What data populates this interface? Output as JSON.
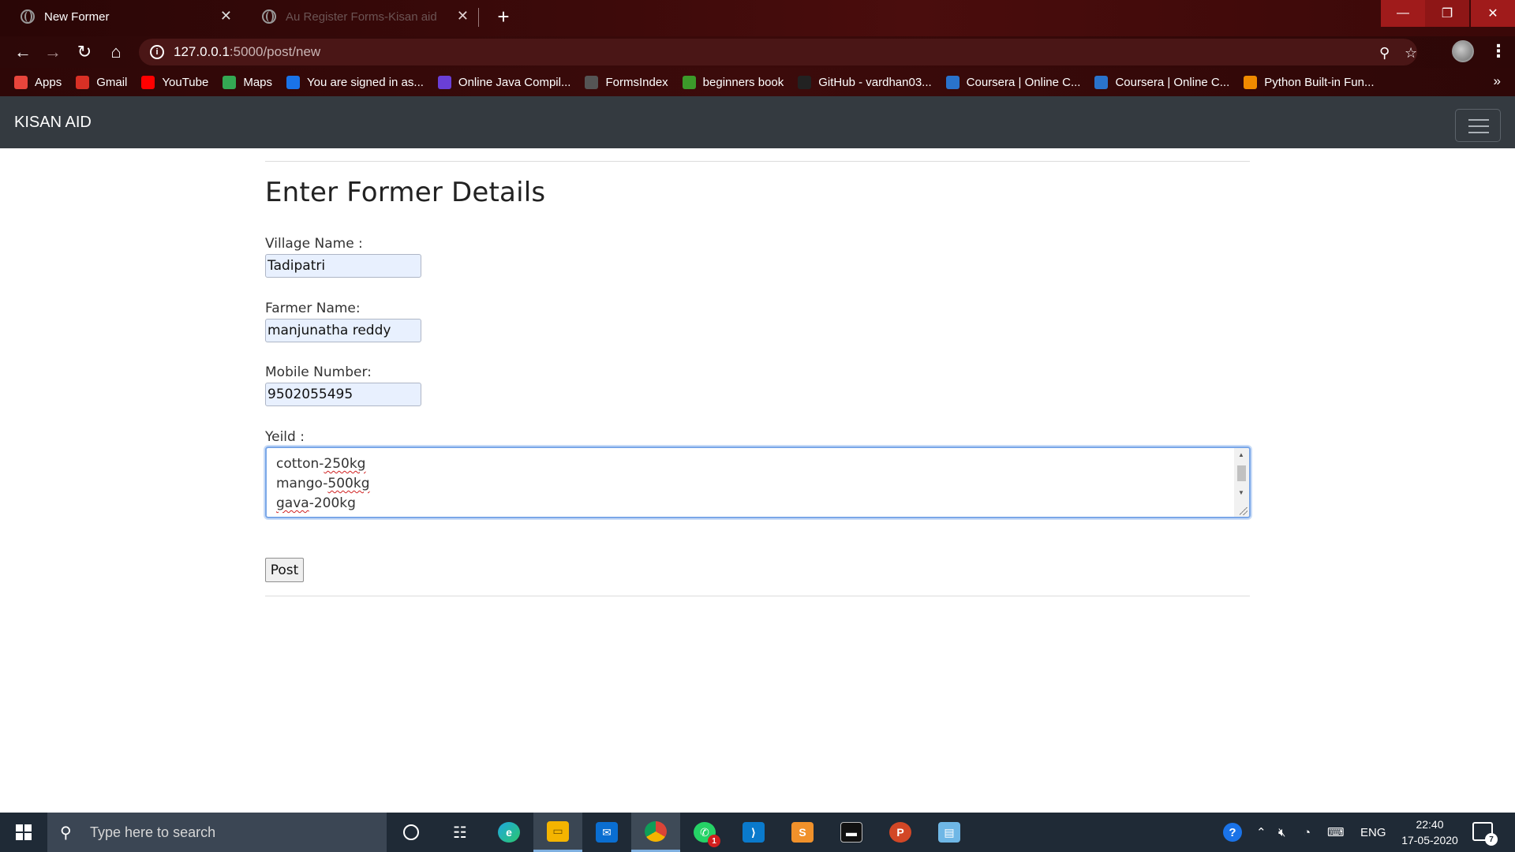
{
  "browser": {
    "tabs": [
      {
        "title": "New Former"
      },
      {
        "title": "Au Register Forms-Kisan aid"
      }
    ],
    "new_tab_symbol": "+",
    "window_controls": {
      "minimize": "—",
      "maximize": "❐",
      "close": "✕"
    },
    "address": {
      "host": "127.0.0.1",
      "path": ":5000/post/new"
    },
    "bookmarks": [
      {
        "label": "Apps",
        "icon": "apps-grid-icon",
        "color": "#e8453c"
      },
      {
        "label": "Gmail",
        "icon": "gmail-icon",
        "color": "#d93025"
      },
      {
        "label": "YouTube",
        "icon": "youtube-icon",
        "color": "#ff0000"
      },
      {
        "label": "Maps",
        "icon": "maps-icon",
        "color": "#34a853"
      },
      {
        "label": "You are signed in as...",
        "icon": "s-icon",
        "color": "#1a73e8"
      },
      {
        "label": "Online Java Compil...",
        "icon": "bolt-icon",
        "color": "#6a3fd6"
      },
      {
        "label": "FormsIndex",
        "icon": "forms-icon",
        "color": "#555555"
      },
      {
        "label": "beginners book",
        "icon": "b-icon",
        "color": "#3c9a2a"
      },
      {
        "label": "GitHub - vardhan03...",
        "icon": "github-icon",
        "color": "#222222"
      },
      {
        "label": "Coursera | Online C...",
        "icon": "coursera-icon",
        "color": "#2a73cc"
      },
      {
        "label": "Coursera | Online C...",
        "icon": "coursera-icon",
        "color": "#2a73cc"
      },
      {
        "label": "Python Built-in Fun...",
        "icon": "cone-icon",
        "color": "#f08a00"
      }
    ],
    "bookmarks_more": "»"
  },
  "app": {
    "brand": "KISAN AID"
  },
  "form": {
    "title": "Enter Former Details",
    "village_label": "Village Name :",
    "village_value": "Tadipatri",
    "farmer_label": "Farmer Name:",
    "farmer_value": "manjunatha reddy",
    "mobile_label": "Mobile Number:",
    "mobile_value": "9502055495",
    "yield_label": "Yeild :",
    "yield_lines": [
      {
        "name": "cotton-",
        "qty": "250kg"
      },
      {
        "name": "mango-",
        "qty": "500kg"
      },
      {
        "name": "gava",
        "qty": "-200kg"
      }
    ],
    "submit_label": "Post"
  },
  "taskbar": {
    "search_placeholder": "Type here to search",
    "apps": [
      {
        "name": "cortana-icon"
      },
      {
        "name": "task-view-icon"
      },
      {
        "name": "edge-icon"
      },
      {
        "name": "file-explorer-icon"
      },
      {
        "name": "mail-icon"
      },
      {
        "name": "chrome-icon"
      },
      {
        "name": "whatsapp-icon",
        "badge": "1"
      },
      {
        "name": "vscode-icon"
      },
      {
        "name": "sublime-text-icon"
      },
      {
        "name": "terminal-icon"
      },
      {
        "name": "powerpoint-icon"
      },
      {
        "name": "notepad-icon"
      }
    ],
    "language": "ENG",
    "time": "22:40",
    "date": "17-05-2020",
    "notification_count": "7"
  }
}
